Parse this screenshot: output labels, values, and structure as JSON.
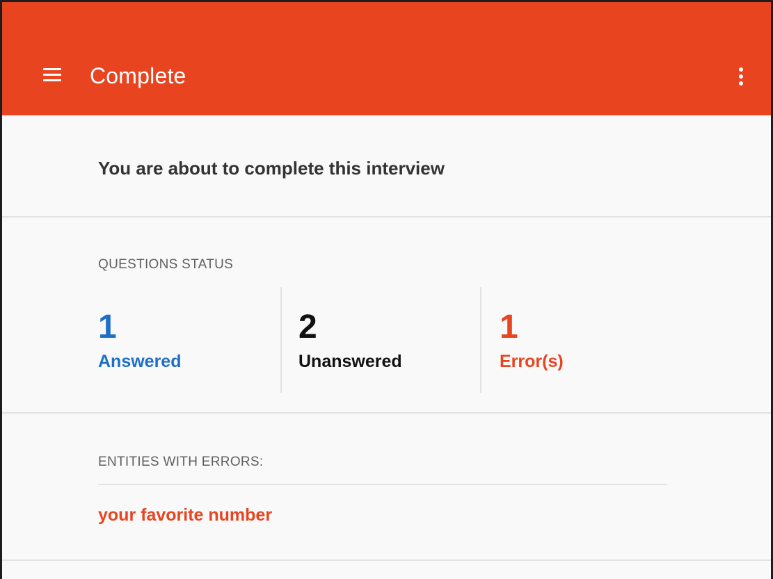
{
  "appbar": {
    "title": "Complete",
    "menu_icon": "hamburger-menu-icon",
    "overflow_icon": "more-vertical-icon",
    "color": "#e8441f"
  },
  "intro": {
    "text": "You are about to complete this interview"
  },
  "questions_status": {
    "label": "QUESTIONS STATUS",
    "answered": {
      "count": "1",
      "label": "Answered",
      "color": "#1e6fc9"
    },
    "unanswered": {
      "count": "2",
      "label": "Unanswered",
      "color": "#111111"
    },
    "errors": {
      "count": "1",
      "label": "Error(s)",
      "color": "#e8441f"
    }
  },
  "entities_with_errors": {
    "label": "ENTITIES WITH ERRORS:",
    "items": [
      {
        "name": "your favorite number",
        "color": "#e8441f"
      }
    ]
  }
}
